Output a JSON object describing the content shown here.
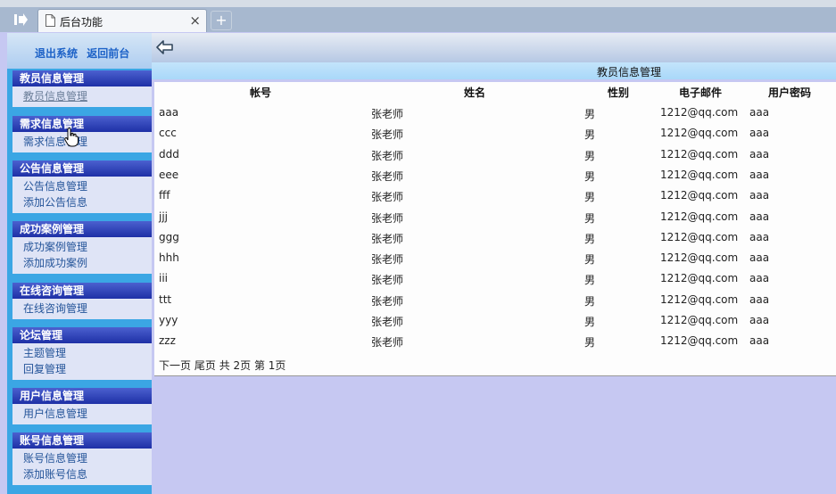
{
  "browser": {
    "tab_title": "后台功能",
    "tab_close": "×",
    "new_tab": "+"
  },
  "sidebar": {
    "top_links": [
      "退出系统",
      "返回前台"
    ],
    "sections": [
      {
        "title": "教员信息管理",
        "items": [
          "教员信息管理"
        ]
      },
      {
        "title": "需求信息管理",
        "items": [
          "需求信息管理"
        ]
      },
      {
        "title": "公告信息管理",
        "items": [
          "公告信息管理",
          "添加公告信息"
        ]
      },
      {
        "title": "成功案例管理",
        "items": [
          "成功案例管理",
          "添加成功案例"
        ]
      },
      {
        "title": "在线咨询管理",
        "items": [
          "在线咨询管理"
        ]
      },
      {
        "title": "论坛管理",
        "items": [
          "主题管理",
          "回复管理"
        ]
      },
      {
        "title": "用户信息管理",
        "items": [
          "用户信息管理"
        ]
      },
      {
        "title": "账号信息管理",
        "items": [
          "账号信息管理",
          "添加账号信息"
        ]
      }
    ]
  },
  "main": {
    "title": "教员信息管理",
    "columns": [
      "帐号",
      "姓名",
      "性别",
      "电子邮件",
      "用户密码"
    ],
    "rows": [
      [
        "aaa",
        "张老师",
        "男",
        "1212@qq.com",
        "aaa"
      ],
      [
        "ccc",
        "张老师",
        "男",
        "1212@qq.com",
        "aaa"
      ],
      [
        "ddd",
        "张老师",
        "男",
        "1212@qq.com",
        "aaa"
      ],
      [
        "eee",
        "张老师",
        "男",
        "1212@qq.com",
        "aaa"
      ],
      [
        "fff",
        "张老师",
        "男",
        "1212@qq.com",
        "aaa"
      ],
      [
        "jjj",
        "张老师",
        "男",
        "1212@qq.com",
        "aaa"
      ],
      [
        "ggg",
        "张老师",
        "男",
        "1212@qq.com",
        "aaa"
      ],
      [
        "hhh",
        "张老师",
        "男",
        "1212@qq.com",
        "aaa"
      ],
      [
        "iii",
        "张老师",
        "男",
        "1212@qq.com",
        "aaa"
      ],
      [
        "ttt",
        "张老师",
        "男",
        "1212@qq.com",
        "aaa"
      ],
      [
        "yyy",
        "张老师",
        "男",
        "1212@qq.com",
        "aaa"
      ],
      [
        "zzz",
        "张老师",
        "男",
        "1212@qq.com",
        "aaa"
      ]
    ],
    "pager": {
      "next": "下一页",
      "last": "尾页",
      "total": "共 2页 第 1页"
    }
  }
}
